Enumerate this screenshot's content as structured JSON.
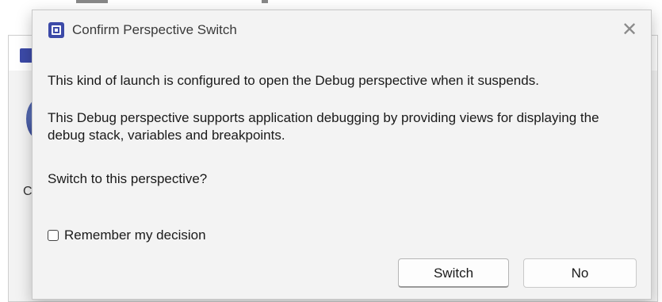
{
  "dialog": {
    "title": "Confirm Perspective Switch",
    "close_symbol": "✕",
    "message_line1": "This kind of launch is configured to open the Debug perspective when it suspends.",
    "message_line2": "This Debug perspective supports application debugging by providing views for displaying the debug stack, variables and breakpoints.",
    "question": "Switch to this perspective?",
    "remember_label": "Remember my decision",
    "remember_checked": false,
    "buttons": {
      "switch": "Switch",
      "no": "No"
    }
  },
  "background": {
    "partial_letter": "C"
  },
  "icons": {
    "title_icon": "eclipse-app-icon",
    "close_icon": "close-icon"
  },
  "colors": {
    "icon_blue": "#3c4aa8",
    "dialog_bg": "#f3f3f3",
    "button_bg": "#fdfdfd"
  }
}
